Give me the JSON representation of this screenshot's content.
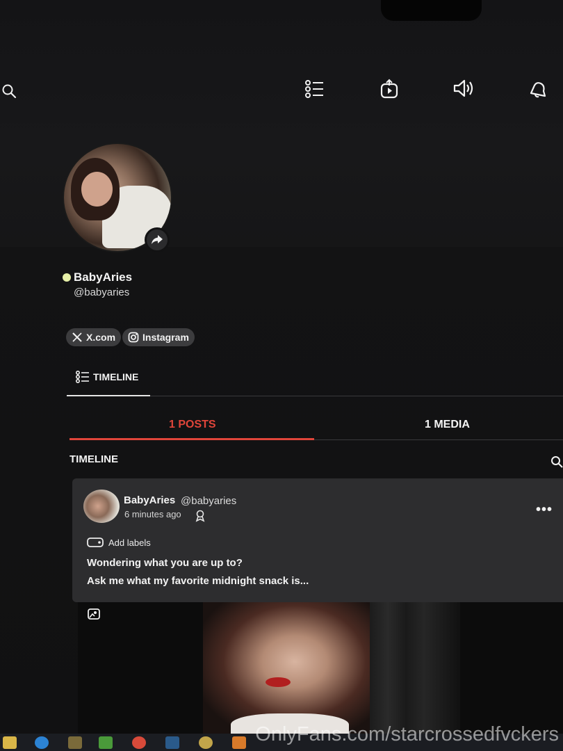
{
  "profile": {
    "display_name": "BabyAries",
    "handle": "@babyaries",
    "online_status": "online"
  },
  "topbar": {
    "icons": [
      "search-icon",
      "list-icon",
      "share-box-icon",
      "volume-icon",
      "bell-icon"
    ]
  },
  "social_links": [
    {
      "label": "X.com",
      "icon": "x-logo-icon"
    },
    {
      "label": "Instagram",
      "icon": "instagram-icon"
    }
  ],
  "tabs": {
    "timeline_label": "TIMELINE"
  },
  "subtabs": {
    "posts_label": "1 POSTS",
    "media_label": "1 MEDIA"
  },
  "section": {
    "title": "TIMELINE"
  },
  "post": {
    "author_name": "BabyAries",
    "author_handle": "@babyaries",
    "time": "6 minutes ago",
    "more": "•••",
    "add_labels": "Add labels",
    "text_line1": "Wondering what you are up to?",
    "text_line2": "Ask me what my favorite midnight snack is..."
  },
  "watermark": "OnlyFans.com/starcrossedfvckers",
  "colors": {
    "accent": "#e0453a",
    "online": "#e7f0a8",
    "background": "#121213",
    "card": "#2d2d2f"
  }
}
